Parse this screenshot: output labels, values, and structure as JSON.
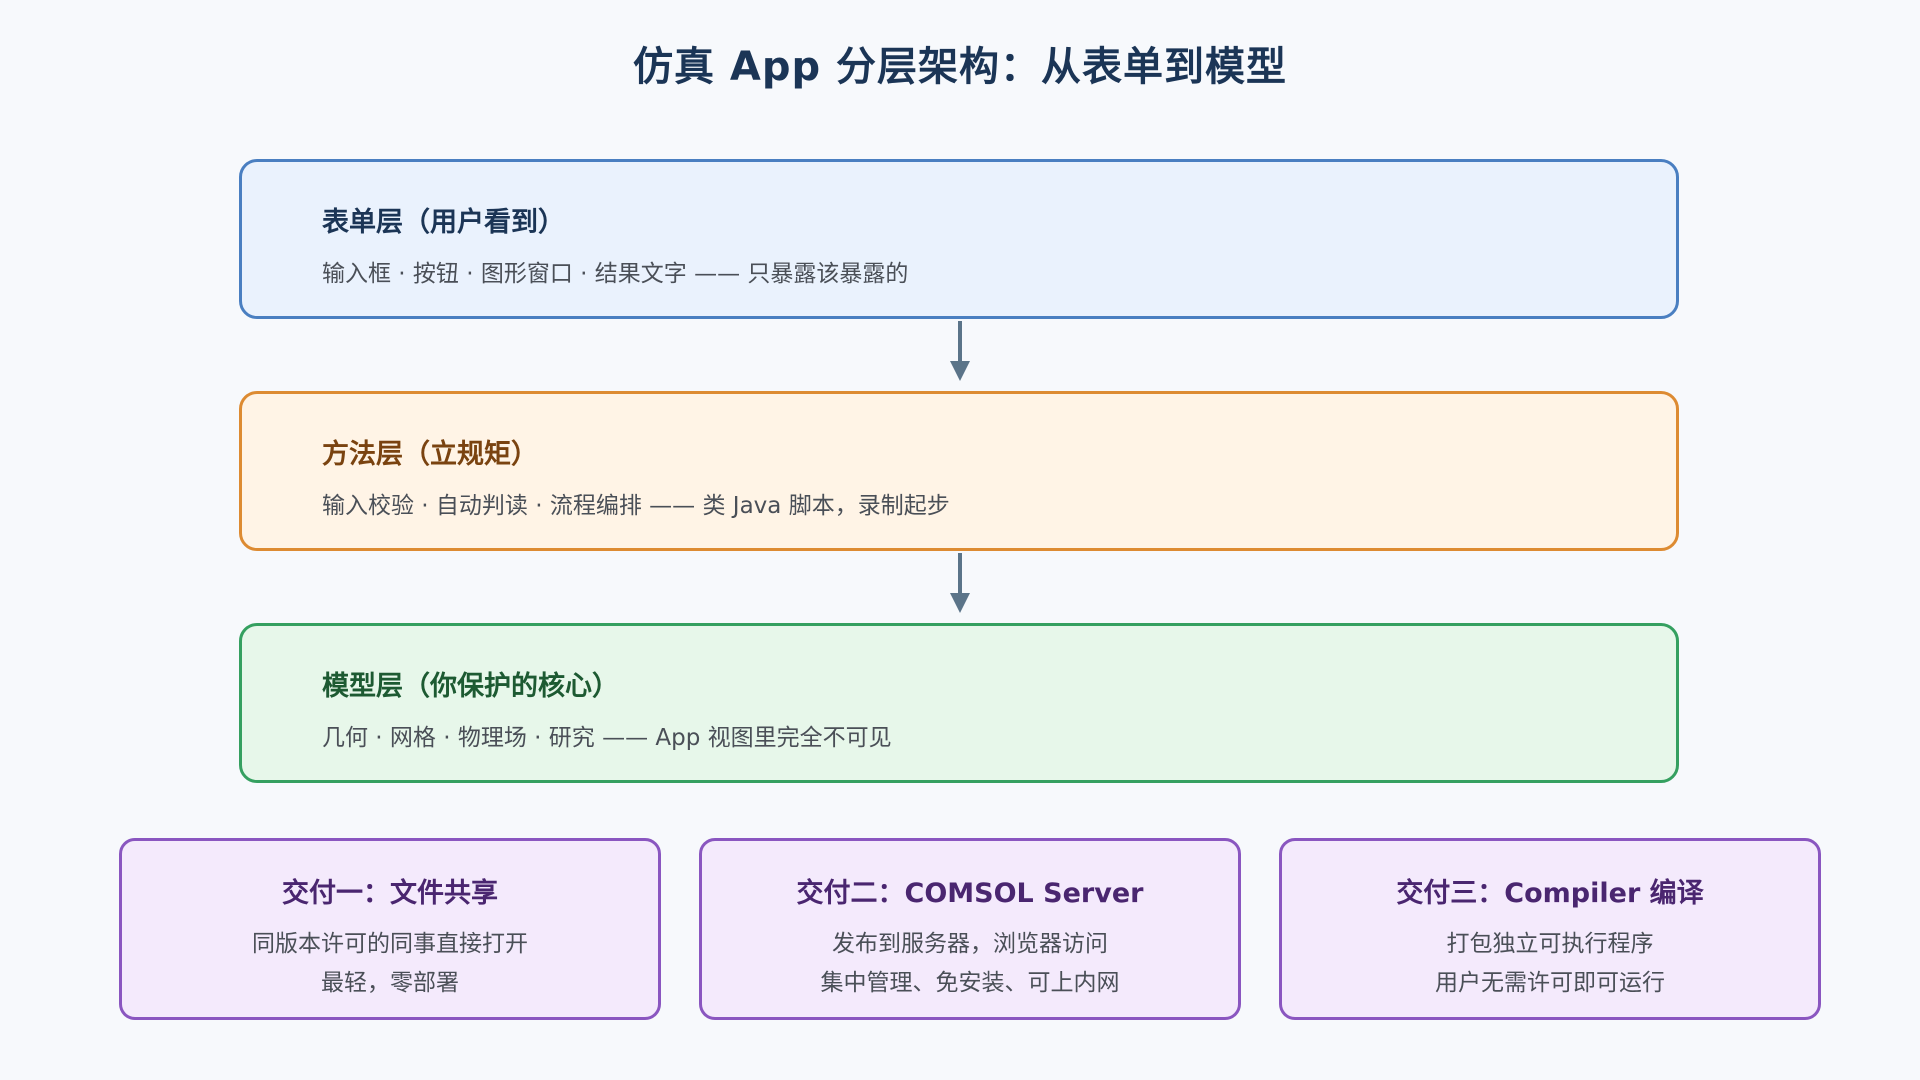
{
  "title": "仿真 App 分层架构：从表单到模型",
  "layers": [
    {
      "title": "表单层（用户看到）",
      "description": "输入框 · 按钮 · 图形窗口 · 结果文字 —— 只暴露该暴露的",
      "border_color": "#4a7fc1",
      "fill_color": "#eaf2fd"
    },
    {
      "title": "方法层（立规矩）",
      "description": "输入校验 · 自动判读 · 流程编排 —— 类 Java 脚本，录制起步",
      "border_color": "#dd8b32",
      "fill_color": "#fff4e6"
    },
    {
      "title": "模型层（你保护的核心）",
      "description": "几何 · 网格 · 物理场 · 研究 —— App 视图里完全不可见",
      "border_color": "#35a060",
      "fill_color": "#e7f7ea"
    }
  ],
  "arrow_color": "#5b7489",
  "deliveries": [
    {
      "title": "交付一：文件共享",
      "lines": [
        "同版本许可的同事直接打开",
        "最轻，零部署"
      ]
    },
    {
      "title": "交付二：COMSOL Server",
      "lines": [
        "发布到服务器，浏览器访问",
        "集中管理、免安装、可上内网"
      ]
    },
    {
      "title": "交付三：Compiler 编译",
      "lines": [
        "打包独立可执行程序",
        "用户无需许可即可运行"
      ]
    }
  ],
  "delivery_border_color": "#8a56c0",
  "delivery_fill_color": "#f4eafc"
}
